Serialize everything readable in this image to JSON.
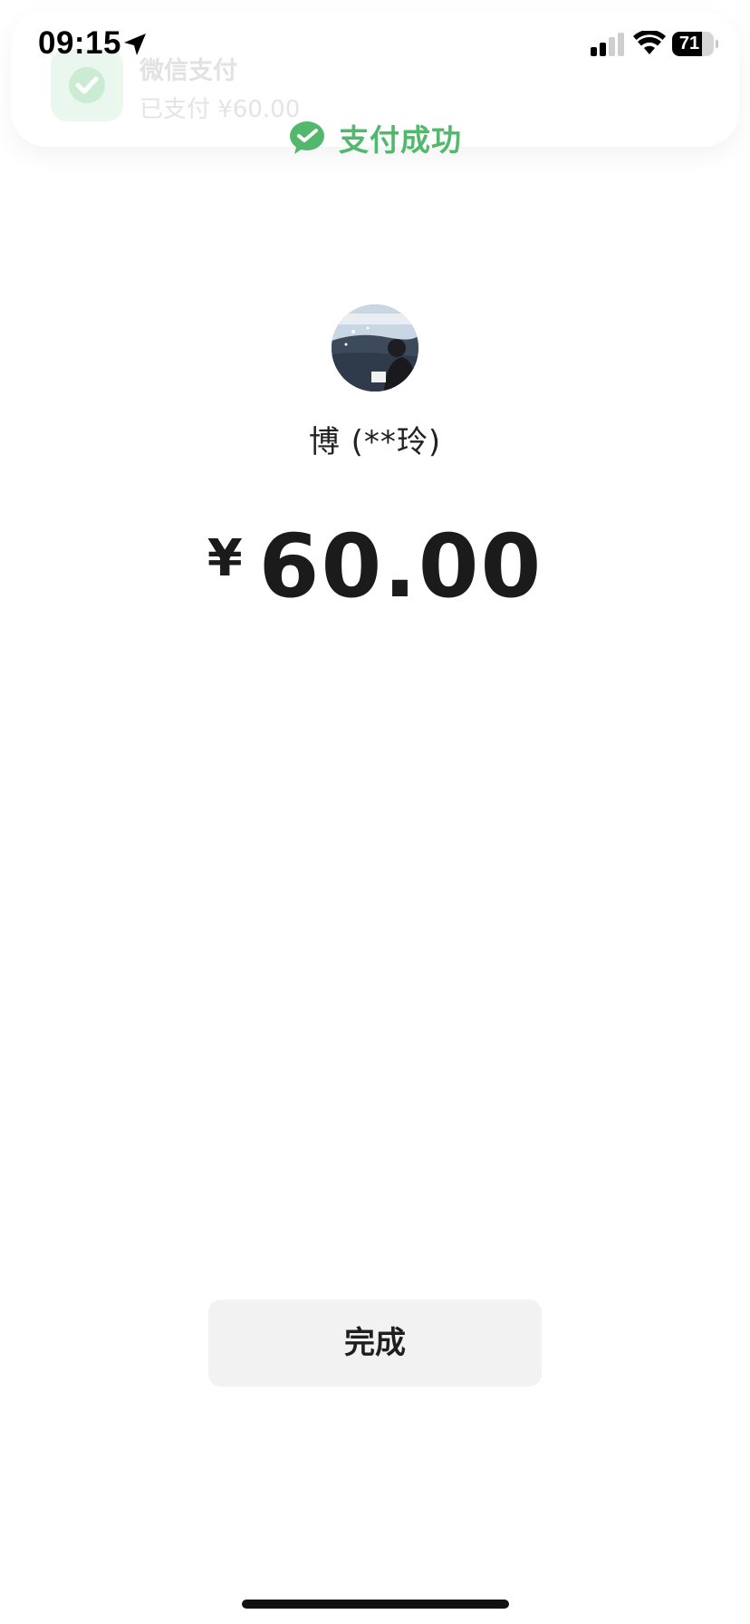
{
  "status_bar": {
    "time": "09:15",
    "battery_level": "71",
    "battery_fraction": 0.71,
    "signal_bars_active": 2,
    "signal_bars_total": 4,
    "icons": [
      "location-arrow-icon",
      "cellular-signal-icon",
      "wifi-icon",
      "battery-icon"
    ]
  },
  "notification": {
    "app_name": "微信支付",
    "message": "已支付 ¥60.00",
    "icon": "wechat-pay-check-icon"
  },
  "header": {
    "title": "支付成功",
    "icon": "wechat-pay-icon",
    "accent_color": "#52b86b"
  },
  "payee": {
    "name": "博 (**玲)",
    "avatar": "avatar-photo"
  },
  "payment": {
    "currency_symbol": "¥",
    "amount": "60.00"
  },
  "actions": {
    "done_label": "完成"
  }
}
